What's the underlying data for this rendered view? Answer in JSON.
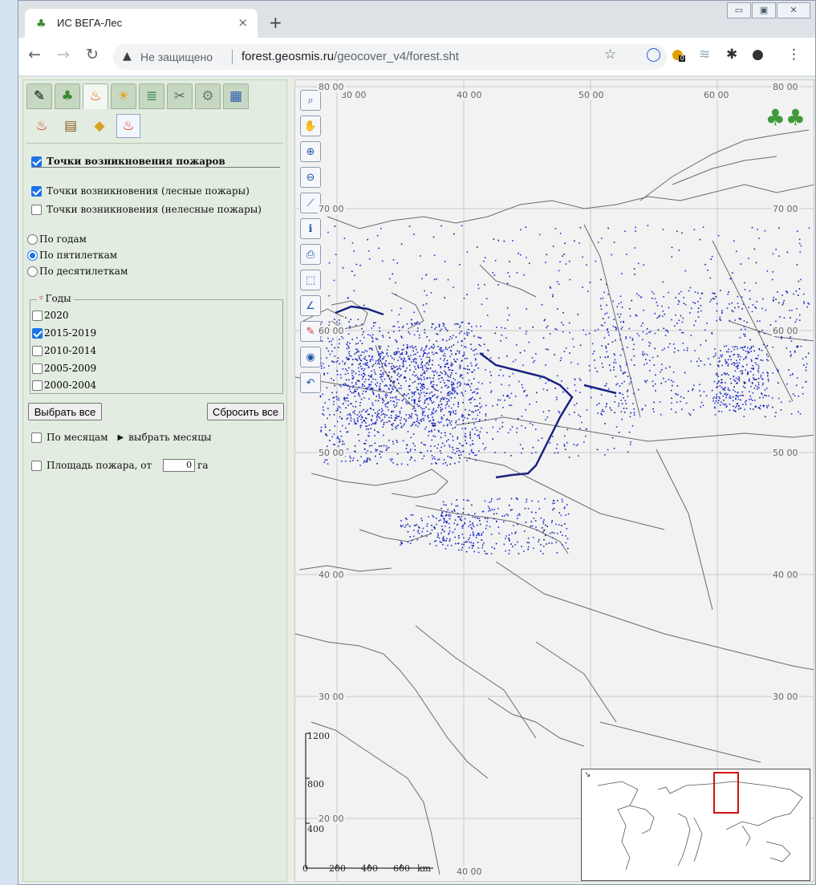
{
  "browser": {
    "tab_title": "ИС ВЕГА-Лес",
    "close_glyph": "×",
    "new_tab_glyph": "+",
    "insecure_label": "Не защищено",
    "url_host": "forest.geosmis.ru",
    "url_path": "/geocover_v4/forest.sht",
    "extension_badge": "0"
  },
  "panel": {
    "section_title": "Точки возникновения пожаров",
    "layers": [
      {
        "label": "Точки возникновения (лесные пожары)",
        "checked": true
      },
      {
        "label": "Точки возникновения (нелесные пожары)",
        "checked": false
      }
    ],
    "grouping": [
      {
        "label": "По годам",
        "selected": false
      },
      {
        "label": "По пятилеткам",
        "selected": true
      },
      {
        "label": "По десятилеткам",
        "selected": false
      }
    ],
    "years_legend": "Годы",
    "years": [
      {
        "label": "2020",
        "checked": false
      },
      {
        "label": "2015-2019",
        "checked": true
      },
      {
        "label": "2010-2014",
        "checked": false
      },
      {
        "label": "2005-2009",
        "checked": false
      },
      {
        "label": "2000-2004",
        "checked": false
      }
    ],
    "select_all": "Выбрать все",
    "reset_all": "Сбросить все",
    "by_months": "По месяцам",
    "choose_months": "выбрать месяцы",
    "area_label": "Площадь пожара, от",
    "area_value": "0",
    "area_unit": "га"
  },
  "map": {
    "lon_labels": [
      "30 00",
      "40 00",
      "50 00",
      "60 00"
    ],
    "lat_labels": [
      "80 00",
      "70 00",
      "60 00",
      "50 00",
      "40 00",
      "30 00",
      "20 00"
    ],
    "bottom_lon_label": "40 00",
    "scale_vertical": [
      "1200",
      "800",
      "400"
    ],
    "scale_horizontal": [
      "0",
      "200",
      "400",
      "600"
    ],
    "scale_unit": "km",
    "colors": {
      "fire_points": "#1f2fd6",
      "fire_points_dark": "#0a1a8c",
      "overview_frame": "#d01010"
    }
  }
}
